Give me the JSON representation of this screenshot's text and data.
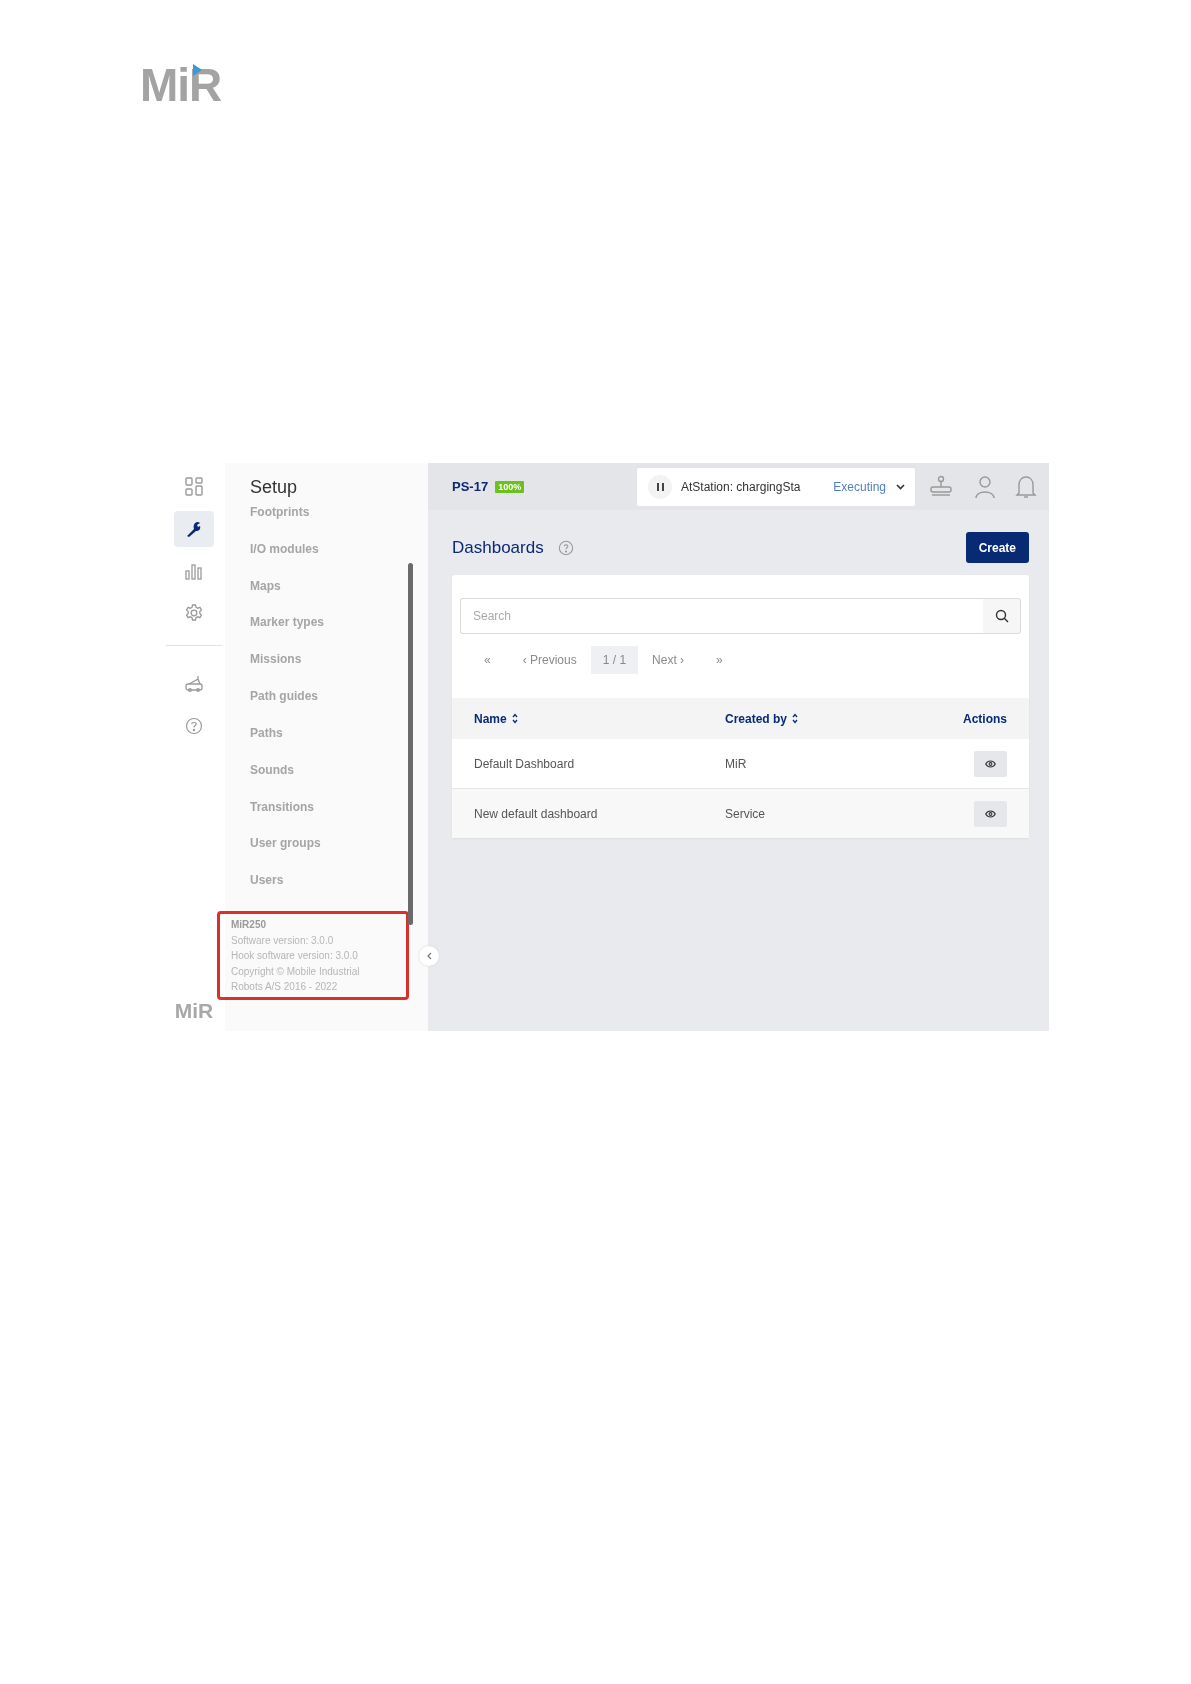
{
  "logo": {
    "text": "MiR"
  },
  "nav_rail": {
    "items": [
      {
        "kind": "dashboard",
        "selected": false
      },
      {
        "kind": "setup",
        "selected": true
      },
      {
        "kind": "analytics",
        "selected": false
      },
      {
        "kind": "settings",
        "selected": false
      },
      {
        "kind": "robot",
        "selected": false
      },
      {
        "kind": "help",
        "selected": false
      }
    ]
  },
  "setup_menu": {
    "title": "Setup",
    "items": [
      "Footprints",
      "I/O modules",
      "Maps",
      "Marker types",
      "Missions",
      "Path guides",
      "Paths",
      "Sounds",
      "Transitions",
      "User groups",
      "Users"
    ]
  },
  "robot_info": {
    "model": "MiR250",
    "lines": [
      "Software version: 3.0.0",
      "Hook software version: 3.0.0",
      "Copyright © Mobile Industrial",
      "Robots A/S 2016 - 2022"
    ]
  },
  "sidebar_logo": "MiR",
  "top_bar": {
    "robot_name": "PS-17",
    "battery": "100%",
    "mission": "AtStation: chargingSta",
    "mission_state": "Executing"
  },
  "page": {
    "title": "Dashboards",
    "create_button": "Create"
  },
  "search": {
    "placeholder": "Search"
  },
  "pagination": {
    "first": "«",
    "previous": "‹ Previous",
    "page": "1 / 1",
    "next": "Next ›",
    "last": "»"
  },
  "table": {
    "columns": [
      {
        "label": "Name",
        "sortable": true
      },
      {
        "label": "Created by",
        "sortable": true
      },
      {
        "label": "Actions",
        "sortable": false
      }
    ],
    "rows": [
      {
        "name": "Default Dashboard",
        "created_by": "MiR"
      },
      {
        "name": "New default dashboard",
        "created_by": "Service"
      }
    ]
  }
}
